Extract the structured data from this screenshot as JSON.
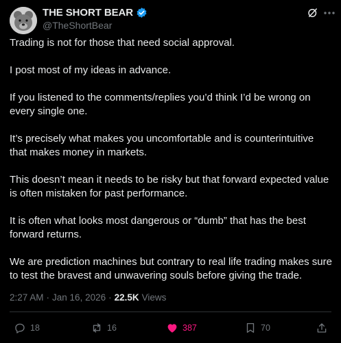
{
  "author": {
    "display_name": "THE SHORT BEAR",
    "handle": "@TheShortBear",
    "verified": true,
    "avatar": "bear-avatar"
  },
  "tweet": {
    "paragraphs": [
      "Trading is not for those that need social approval.",
      "I post most of my ideas in advance.",
      "If you listened to the comments/replies you’d think I’d be wrong on every single one.",
      "It’s precisely what makes you uncomfortable and is counterintuitive that makes money in markets.",
      "This doesn’t mean it needs to be risky but that forward expected value is often mistaken for past performance.",
      "It is often what looks most dangerous or “dumb” that has the best forward returns.",
      "We are prediction machines but contrary to real life trading makes sure to test the bravest and unwavering souls before giving the trade."
    ],
    "time": "2:27 AM",
    "separator": "·",
    "date": "Jan 16, 2026",
    "views_count": "22.5K",
    "views_label": "Views"
  },
  "actions": {
    "replies": "18",
    "reposts": "16",
    "likes": "387",
    "bookmarks": "70"
  },
  "colors": {
    "background": "#000000",
    "text": "#e7e9ea",
    "muted": "#71767b",
    "verified": "#1d9bf0",
    "like": "#f91880"
  }
}
